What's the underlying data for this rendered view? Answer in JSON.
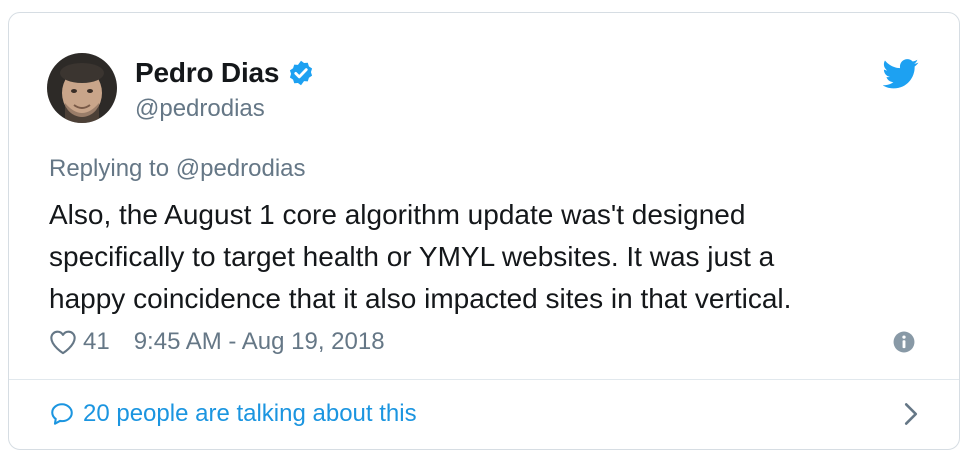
{
  "author": {
    "name": "Pedro Dias",
    "handle": "@pedrodias",
    "verified": true
  },
  "tweet": {
    "replying_to": "Replying to @pedrodias",
    "lines": [
      "Also, the August 1 core algorithm update was't designed",
      "specifically to target health or YMYL websites. It was just a",
      "happy coincidence that it also impacted sites in that vertical."
    ],
    "likes": "41",
    "timestamp": "9:45 AM - Aug 19, 2018"
  },
  "footer": {
    "talking_label": "20 people are talking about this"
  },
  "icons": {
    "brand": "twitter-bird-icon",
    "verified": "verified-badge-icon",
    "like": "heart-icon",
    "info": "info-icon",
    "reply": "speech-bubble-icon",
    "more": "chevron-right-icon"
  },
  "colors": {
    "brand_blue": "#1da1f2",
    "link_blue": "#1b95e0",
    "text": "#14171a",
    "muted": "#657786",
    "border": "#d6dde3"
  }
}
